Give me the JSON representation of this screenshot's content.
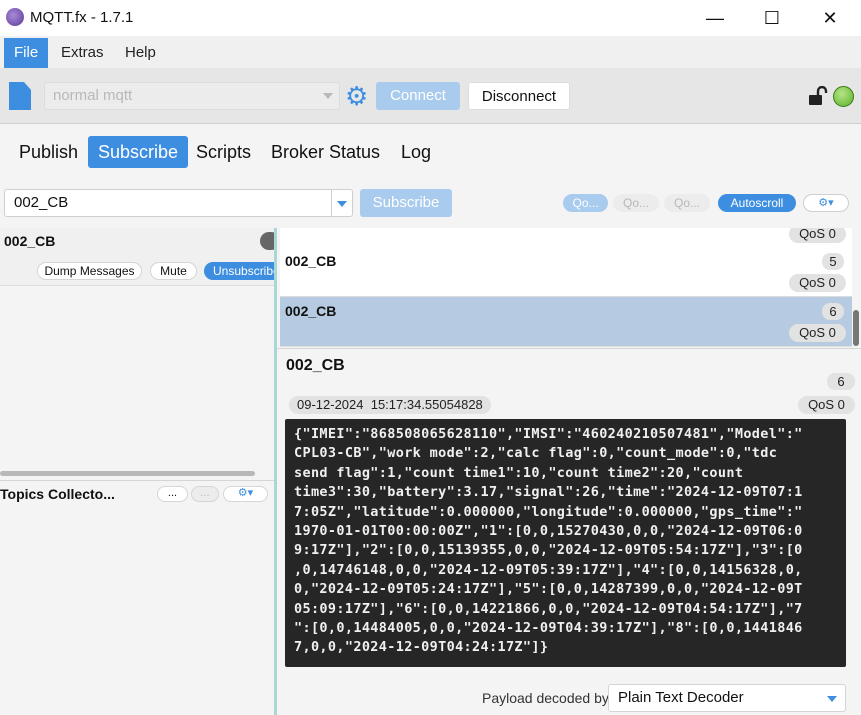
{
  "window": {
    "title": "MQTT.fx - 1.7.1",
    "minimize_glyph": "—",
    "maximize_glyph": "☐",
    "close_glyph": "✕"
  },
  "menu": {
    "items": [
      {
        "label": "File",
        "active": true
      },
      {
        "label": "Extras",
        "active": false
      },
      {
        "label": "Help",
        "active": false
      }
    ]
  },
  "connection": {
    "profile": "normal mqtt",
    "connect_label": "Connect",
    "disconnect_label": "Disconnect",
    "status": "connected",
    "status_color": "#5bb12a"
  },
  "tabs": [
    {
      "label": "Publish",
      "active": false
    },
    {
      "label": "Subscribe",
      "active": true
    },
    {
      "label": "Scripts",
      "active": false
    },
    {
      "label": "Broker Status",
      "active": false
    },
    {
      "label": "Log",
      "active": false
    }
  ],
  "subscribe": {
    "topic_value": "002_CB",
    "subscribe_label": "Subscribe",
    "qos_buttons": [
      "Qo...",
      "Qo...",
      "Qo..."
    ],
    "autoscroll_label": "Autoscroll",
    "options_glyph": "⚙▾"
  },
  "subscriptions": {
    "topic": "002_CB",
    "dump_label": "Dump Messages",
    "mute_label": "Mute",
    "unsubscribe_label": "Unsubscribe"
  },
  "topics_collector": {
    "title": "Topics Collecto...",
    "btn1": "...",
    "btn2": "...",
    "options_glyph": "⚙▾"
  },
  "messages": {
    "top_qos": "QoS 0",
    "items": [
      {
        "topic": "002_CB",
        "num": "5",
        "qos": "QoS 0",
        "selected": false
      },
      {
        "topic": "002_CB",
        "num": "6",
        "qos": "QoS 0",
        "selected": true
      }
    ]
  },
  "detail": {
    "topic": "002_CB",
    "num": "6",
    "timestamp": "09-12-2024  15:17:34.55054828",
    "qos": "QoS 0",
    "payload": "{\"IMEI\":\"868508065628110\",\"IMSI\":\"460240210507481\",\"Model\":\"\nCPL03-CB\",\"work mode\":2,\"calc flag\":0,\"count_mode\":0,\"tdc\nsend flag\":1,\"count time1\":10,\"count time2\":20,\"count\ntime3\":30,\"battery\":3.17,\"signal\":26,\"time\":\"2024-12-09T07:1\n7:05Z\",\"latitude\":0.000000,\"longitude\":0.000000,\"gps_time\":\"\n1970-01-01T00:00:00Z\",\"1\":[0,0,15270430,0,0,\"2024-12-09T06:0\n9:17Z\"],\"2\":[0,0,15139355,0,0,\"2024-12-09T05:54:17Z\"],\"3\":[0\n,0,14746148,0,0,\"2024-12-09T05:39:17Z\"],\"4\":[0,0,14156328,0,\n0,\"2024-12-09T05:24:17Z\"],\"5\":[0,0,14287399,0,0,\"2024-12-09T\n05:09:17Z\"],\"6\":[0,0,14221866,0,0,\"2024-12-09T04:54:17Z\"],\"7\n\":[0,0,14484005,0,0,\"2024-12-09T04:39:17Z\"],\"8\":[0,0,1441846\n7,0,0,\"2024-12-09T04:24:17Z\"]}",
    "decoder_label": "Payload decoded by",
    "decoder_value": "Plain Text Decoder"
  }
}
